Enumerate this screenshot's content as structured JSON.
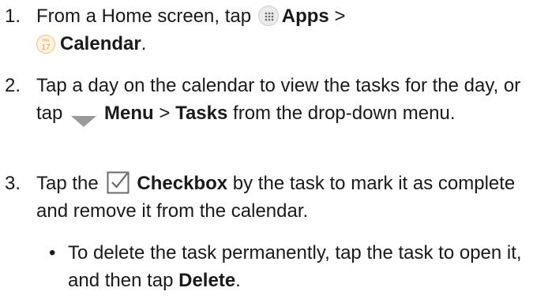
{
  "steps": [
    {
      "number": "1.",
      "line1_text": "From a Home screen, tap",
      "apps_label": "Apps",
      "separator": ">",
      "calendar_label": "Calendar",
      "calendar_icon_day": "THU",
      "calendar_icon_date": "17",
      "end": "."
    },
    {
      "number": "2.",
      "text_a": "Tap a day on the calendar to view the tasks for the day, or tap",
      "menu_label": "Menu",
      "separator": ">",
      "tasks_label": "Tasks",
      "text_b": "from the drop-down menu."
    },
    {
      "number": "3.",
      "text_a": "Tap the",
      "checkbox_label": "Checkbox",
      "text_b": "by the task to mark it as complete and remove it from the calendar."
    }
  ],
  "bullet": {
    "marker": "•",
    "text_a": "To delete the task permanently, tap the task to open it, and then tap",
    "delete_label": "Delete",
    "end": "."
  },
  "colors": {
    "text": "#1a1a1a",
    "calendar_accent": "#f2a33a",
    "menu_triangle": "#9a9a9a",
    "checkbox_stroke": "#6b6b6b"
  },
  "icons": {
    "apps": "apps-grid-icon",
    "calendar": "calendar-icon",
    "menu": "dropdown-triangle-icon",
    "checkbox": "checkbox-icon"
  }
}
